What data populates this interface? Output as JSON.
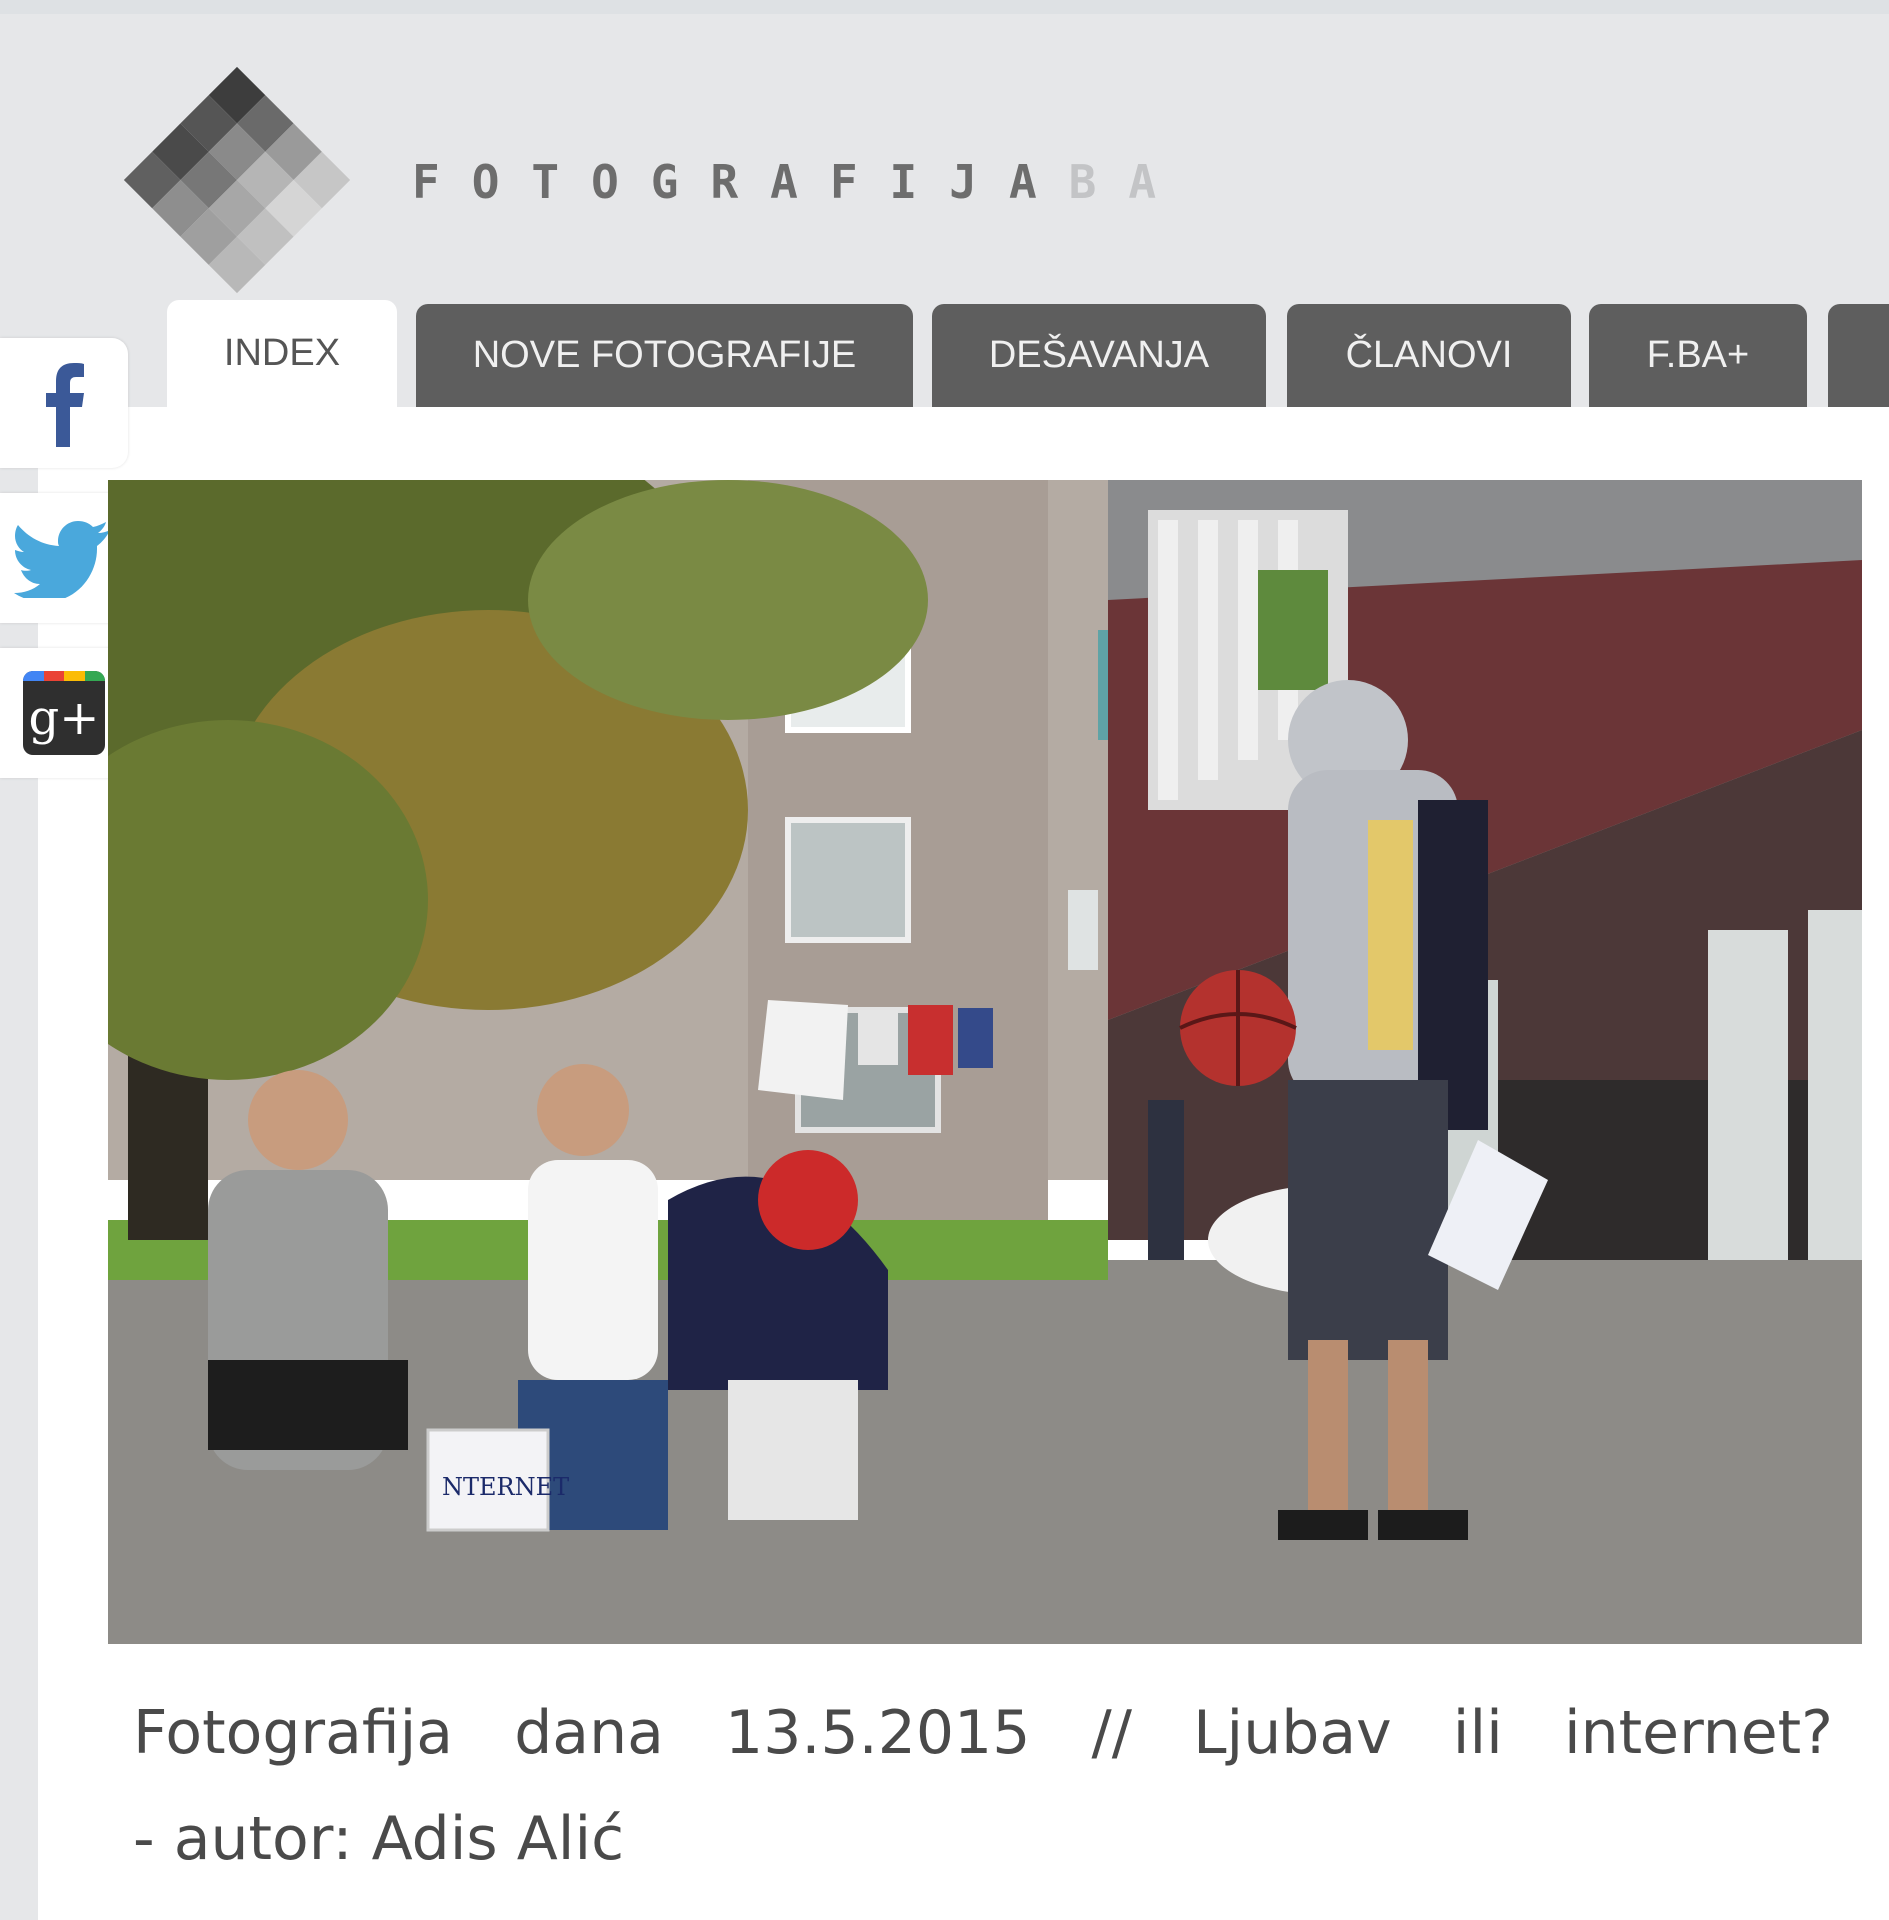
{
  "site": {
    "brand_main": "FOTOGRAFIJA",
    "brand_suffix": "BA"
  },
  "nav": {
    "tabs": [
      {
        "label": "INDEX",
        "active": true
      },
      {
        "label": "NOVE FOTOGRAFIJE"
      },
      {
        "label": "DEŠAVANJA"
      },
      {
        "label": "ČLANOVI"
      },
      {
        "label": "F.BA+"
      }
    ]
  },
  "social": {
    "facebook_glyph": "f",
    "googleplus_glyph": "g+"
  },
  "caption": {
    "line1": "Fotografija dana 13.5.2015 // Ljubav ili internet?",
    "line2": "- autor: Adis Alić"
  },
  "colors": {
    "nav_tab": "#5e5e5e",
    "background": "#e6e7e9",
    "facebook": "#3b5998",
    "twitter": "#4aa8dc"
  }
}
